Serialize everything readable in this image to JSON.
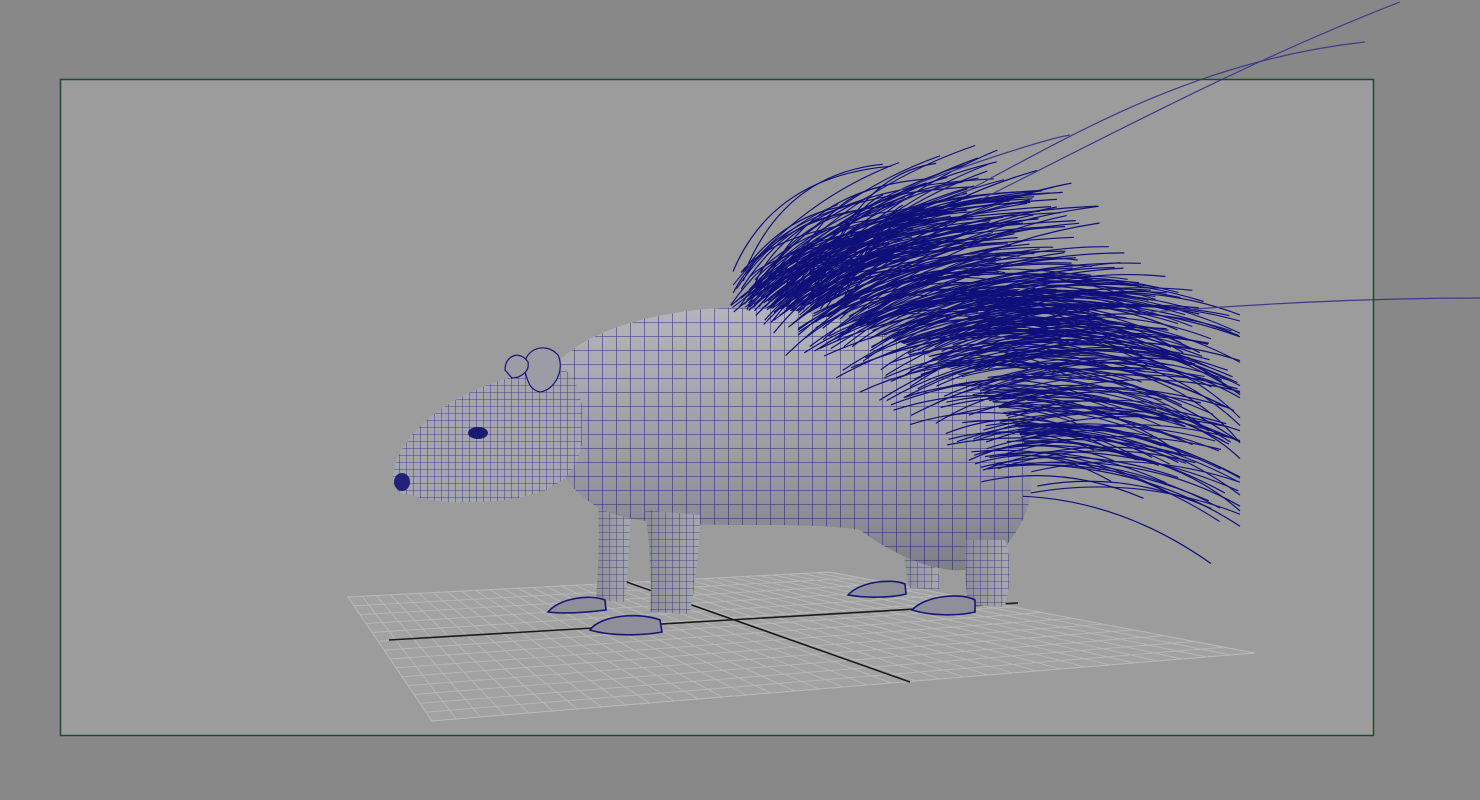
{
  "viewport": {
    "panel_name": "",
    "background_color": "#888888",
    "gate_fill_color": "#9c9c9c",
    "gate_border_color": "#1f4a2a"
  },
  "scene": {
    "grid_color": "#b4b4b4",
    "axis_color": "#1a1a1a",
    "wireframe_color": "#11117a",
    "mesh_fill_color": "#9a9aa4",
    "objects": [
      "porcupine-mesh",
      "quill-curves",
      "ground-grid"
    ]
  }
}
